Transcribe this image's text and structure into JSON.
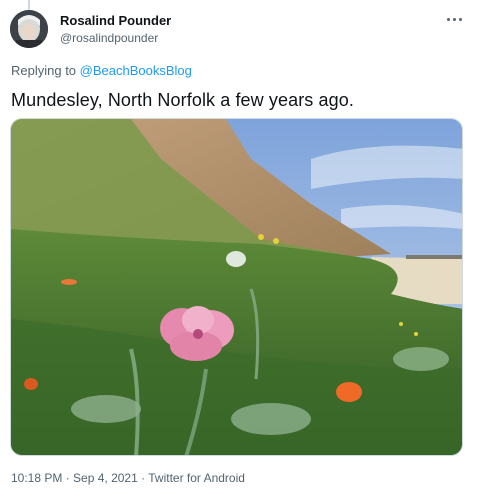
{
  "author": {
    "display_name": "Rosalind Pounder",
    "handle": "@rosalindpounder"
  },
  "reply": {
    "prefix": "Replying to ",
    "to_handle": "@BeachBooksBlog"
  },
  "tweet": {
    "text": "Mundesley, North Norfolk a few years ago.",
    "time": "10:18 PM",
    "separator1": " · ",
    "date": "Sep 4, 2021",
    "separator2": " · ",
    "source": "Twitter for Android"
  },
  "colors": {
    "link": "#1d9bf0",
    "secondary_text": "#536471"
  },
  "icons": {
    "more": "more-horizontal-icon"
  }
}
